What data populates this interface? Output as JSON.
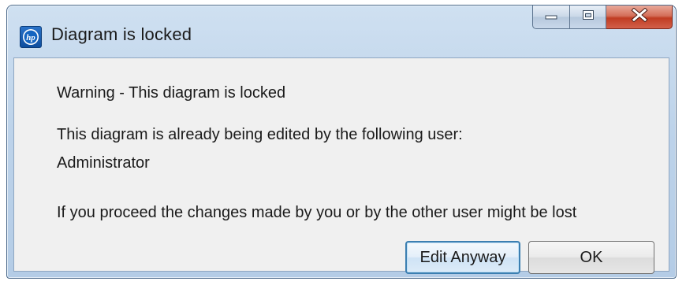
{
  "window": {
    "title": "Diagram is locked",
    "app_icon": "hp-logo-icon"
  },
  "controls": {
    "minimize_icon": "minimize-icon",
    "maximize_icon": "maximize-icon",
    "close_icon": "close-icon"
  },
  "message": {
    "warning": "Warning - This diagram is locked",
    "editing_notice": "This diagram is already being edited by the following user:",
    "user": "Administrator",
    "consequence": "If you proceed the changes made by you or by the other user might be lost"
  },
  "buttons": {
    "edit_anyway": "Edit Anyway",
    "ok": "OK"
  },
  "colors": {
    "close_button": "#c8452b",
    "titlebar": "#bdd3ea",
    "client_background": "#f0f0f0",
    "default_button_border": "#3c7fb1"
  }
}
